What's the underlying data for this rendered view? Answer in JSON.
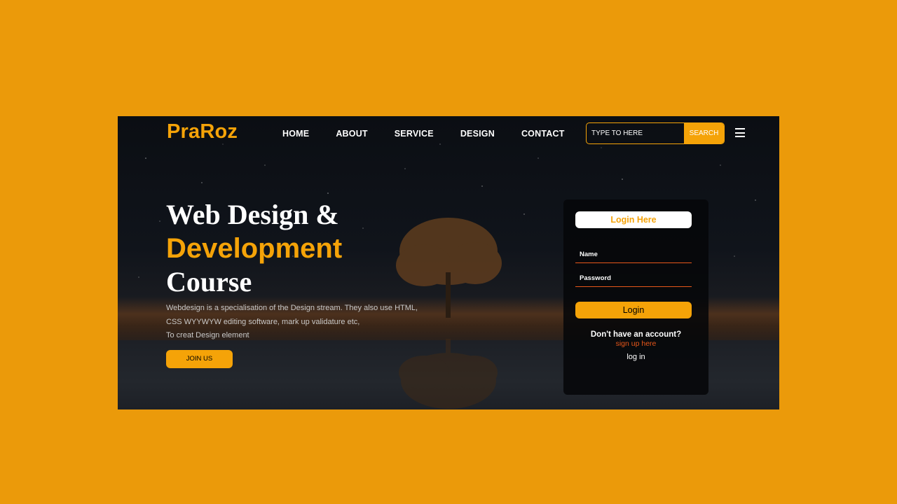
{
  "brand": {
    "logo": "PraRoz"
  },
  "nav": {
    "items": [
      "HOME",
      "ABOUT",
      "SERVICE",
      "DESIGN",
      "CONTACT"
    ]
  },
  "search": {
    "placeholder": "TYPE TO HERE",
    "button_label": "SEARCH"
  },
  "hero": {
    "line1": "Web Design &",
    "line2": "Development",
    "line3": "Course",
    "desc1": "Webdesign is a specialisation of the Design stream. They also use HTML,",
    "desc2": "CSS WYYWYW editing software, mark up validature etc,",
    "desc3": "To creat Design element",
    "cta": "JOIN US"
  },
  "login": {
    "title": "Login Here",
    "name_label": "Name",
    "password_label": "Password",
    "button_label": "Login",
    "no_account": "Don't have an account?",
    "signup_link": "sign up here",
    "log_in_text": "log in"
  },
  "colors": {
    "page_bg": "#eb9a0a",
    "accent": "#f5a308",
    "underline": "#e8571a"
  }
}
